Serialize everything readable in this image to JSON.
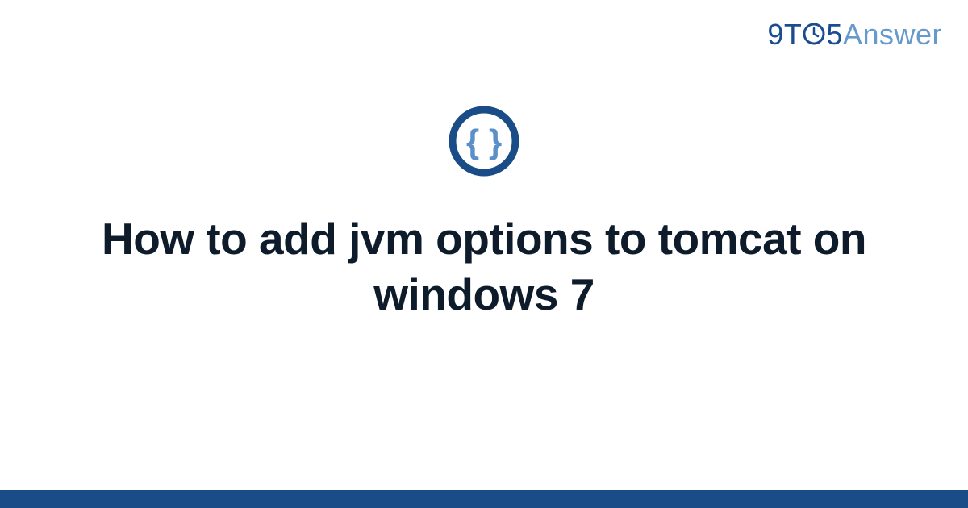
{
  "brand": {
    "part1": "9",
    "part2": "T",
    "part3": "5",
    "part4": "Answer"
  },
  "icon": {
    "name": "code-braces-icon",
    "ring_color": "#1a4d87",
    "brace_color": "#5a8fc7"
  },
  "title": "How to add jvm options to tomcat on windows 7",
  "colors": {
    "footer": "#1a4d87",
    "brand_primary": "#1a4d8f",
    "brand_secondary": "#6699cc"
  }
}
